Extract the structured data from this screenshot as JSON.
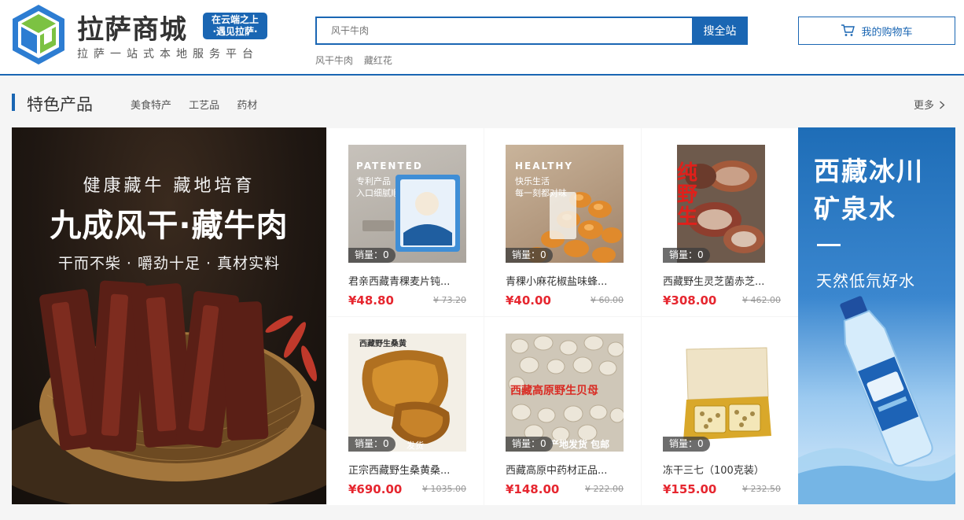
{
  "header": {
    "brand_title": "拉萨商城",
    "slogan_line1": "在云端之上",
    "slogan_line2": "·遇见拉萨·",
    "brand_sub": "拉萨一站式本地服务平台",
    "search_placeholder": "风干牛肉",
    "search_button": "搜全站",
    "hot_words": [
      "风干牛肉",
      "藏红花"
    ],
    "cart_label": "我的购物车",
    "accent_color": "#1a66b3"
  },
  "section": {
    "title": "特色产品",
    "tabs": [
      "美食特产",
      "工艺品",
      "药材"
    ],
    "more_label": "更多"
  },
  "banner_left": {
    "line1": "健康藏牛  藏地培育",
    "line2": "九成风干·藏牛肉",
    "line3": "干而不柴 · 嚼劲十足 · 真材实料"
  },
  "banner_right": {
    "title_line1": "西藏冰川",
    "title_line2": "矿泉水",
    "subtitle": "天然低氘好水"
  },
  "products": [
    {
      "sales": "销量：0",
      "name": "君亲西藏青稞麦片钝...",
      "price": "¥48.80",
      "original_price": "¥ 73.20",
      "overlay_1": "PATENTED",
      "overlay_2": "专利产品",
      "overlay_3": "入口细腻顺滑"
    },
    {
      "sales": "销量：0",
      "name": "青稞小麻花椒盐味蜂...",
      "price": "¥40.00",
      "original_price": "¥ 60.00",
      "overlay_1": "HEALTHY",
      "overlay_2": "快乐生活",
      "overlay_3": "每一刻都对味"
    },
    {
      "sales": "销量：0",
      "name": "西藏野生灵芝菌赤芝...",
      "price": "¥308.00",
      "original_price": "¥ 462.00",
      "overlay_1": "纯野生"
    },
    {
      "sales": "销量：0",
      "name": "正宗西藏野生桑黄桑...",
      "price": "¥690.00",
      "original_price": "¥ 1035.00",
      "overlay_1": "西藏野生桑黄",
      "overlay_2": "发货"
    },
    {
      "sales": "销量：0",
      "name": "西藏高原中药材正品...",
      "price": "¥148.00",
      "original_price": "¥ 222.00",
      "overlay_1": "西藏高原野生贝母",
      "overlay_2": "产地发货 包邮"
    },
    {
      "sales": "销量：0",
      "name": "冻干三七（100克装）",
      "price": "¥155.00",
      "original_price": "¥ 232.50"
    }
  ]
}
